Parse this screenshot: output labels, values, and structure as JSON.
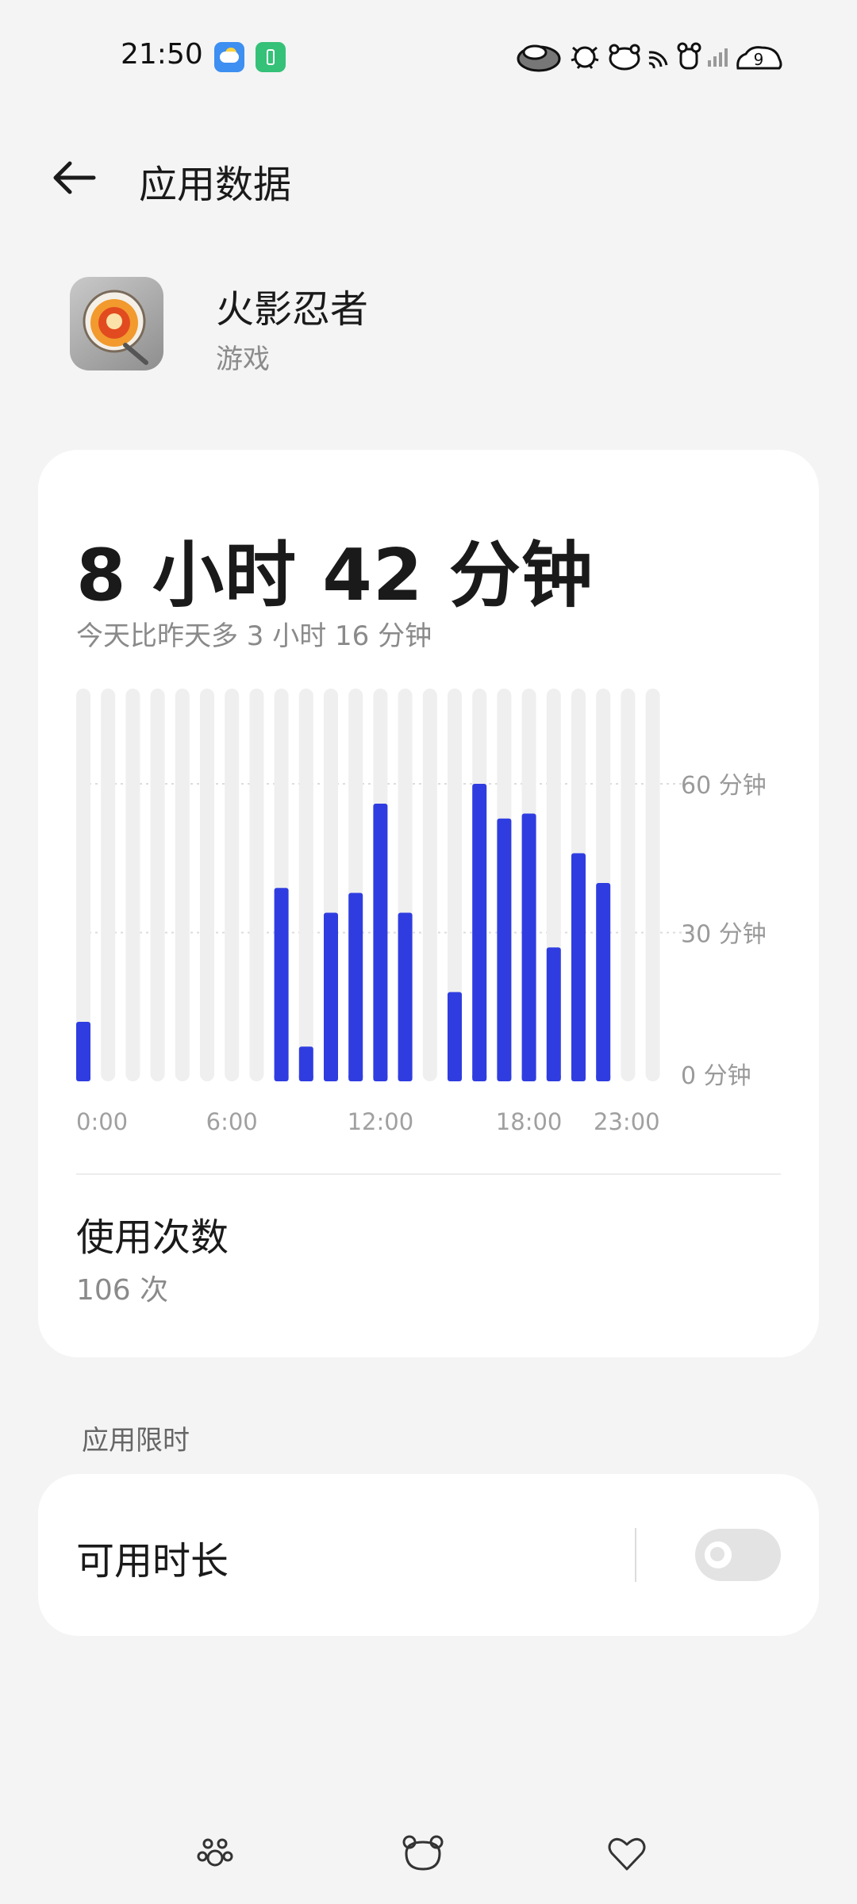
{
  "status_bar": {
    "time": "21:50",
    "left_icons": [
      "weather-icon",
      "battery-saver-icon"
    ],
    "right_icons": [
      "sheep-icon",
      "bug-icon",
      "pig-icon",
      "wifi-icon",
      "mouse-icon",
      "signal-bars-icon",
      "battery-icon"
    ],
    "battery_level": "9"
  },
  "header": {
    "back_icon": "arrow-left-icon",
    "title": "应用数据"
  },
  "app": {
    "name": "火影忍者",
    "category": "游戏"
  },
  "usage": {
    "total": "8 小时 42 分钟",
    "comparison": "今天比昨天多 3 小时 16 分钟",
    "count_title": "使用次数",
    "count_value": "106 次"
  },
  "chart_data": {
    "type": "bar",
    "categories": [
      "0:00",
      "1:00",
      "2:00",
      "3:00",
      "4:00",
      "5:00",
      "6:00",
      "7:00",
      "8:00",
      "9:00",
      "10:00",
      "11:00",
      "12:00",
      "13:00",
      "14:00",
      "15:00",
      "16:00",
      "17:00",
      "18:00",
      "19:00",
      "20:00",
      "21:00",
      "22:00",
      "23:00"
    ],
    "values": [
      12,
      0,
      0,
      0,
      0,
      0,
      0,
      0,
      39,
      7,
      34,
      38,
      56,
      34,
      0,
      18,
      60,
      53,
      54,
      27,
      46,
      40,
      0,
      0
    ],
    "x_tick_labels": [
      "0:00",
      "6:00",
      "12:00",
      "18:00",
      "23:00"
    ],
    "y_tick_labels": [
      "60 分钟",
      "30 分钟",
      "0 分钟"
    ],
    "y_ticks": [
      60,
      30,
      0
    ],
    "ylim": [
      0,
      60
    ],
    "bar_color": "#2f3de0",
    "track_color": "#efefef",
    "grid": "dotted"
  },
  "limits": {
    "section_label": "应用限时",
    "available_duration_label": "可用时长",
    "toggle_on": false
  },
  "nav_bar": {
    "icons": [
      "paw-icon",
      "bear-face-icon",
      "heart-icon"
    ]
  }
}
